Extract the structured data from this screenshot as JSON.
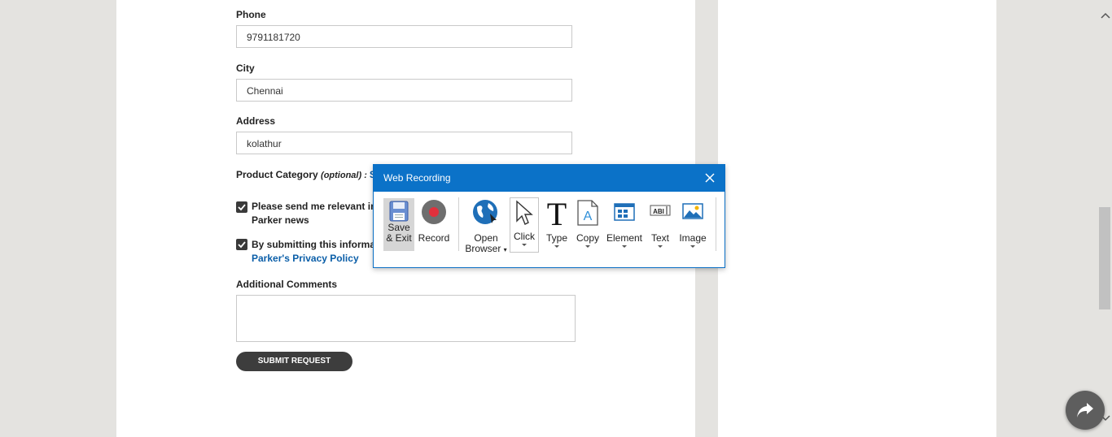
{
  "form": {
    "phone_label": "Phone",
    "phone_value": "9791181720",
    "city_label": "City",
    "city_value": "Chennai",
    "address_label": "Address",
    "address_value": "kolathur",
    "product_category_label": "Product Category",
    "product_category_optional": "(optional)",
    "product_category_sep": " : ",
    "product_category_link": "Se",
    "consent1_line1": "Please send me relevant inf",
    "consent1_line2": "Parker news",
    "consent2_line1": "By submitting this informati",
    "consent2_link": "Parker's Privacy Policy",
    "comments_label": "Additional Comments",
    "submit_label": "SUBMIT REQUEST"
  },
  "dialog": {
    "title": "Web Recording",
    "tools": {
      "save_exit_1": "Save",
      "save_exit_2": "& Exit",
      "record": "Record",
      "open_browser_1": "Open",
      "open_browser_2": "Browser",
      "click": "Click",
      "type": "Type",
      "copy": "Copy",
      "element": "Element",
      "text": "Text",
      "image": "Image"
    }
  },
  "colors": {
    "accent": "#0b72c8",
    "link": "#0a5ea8",
    "record": "#e0303c"
  }
}
